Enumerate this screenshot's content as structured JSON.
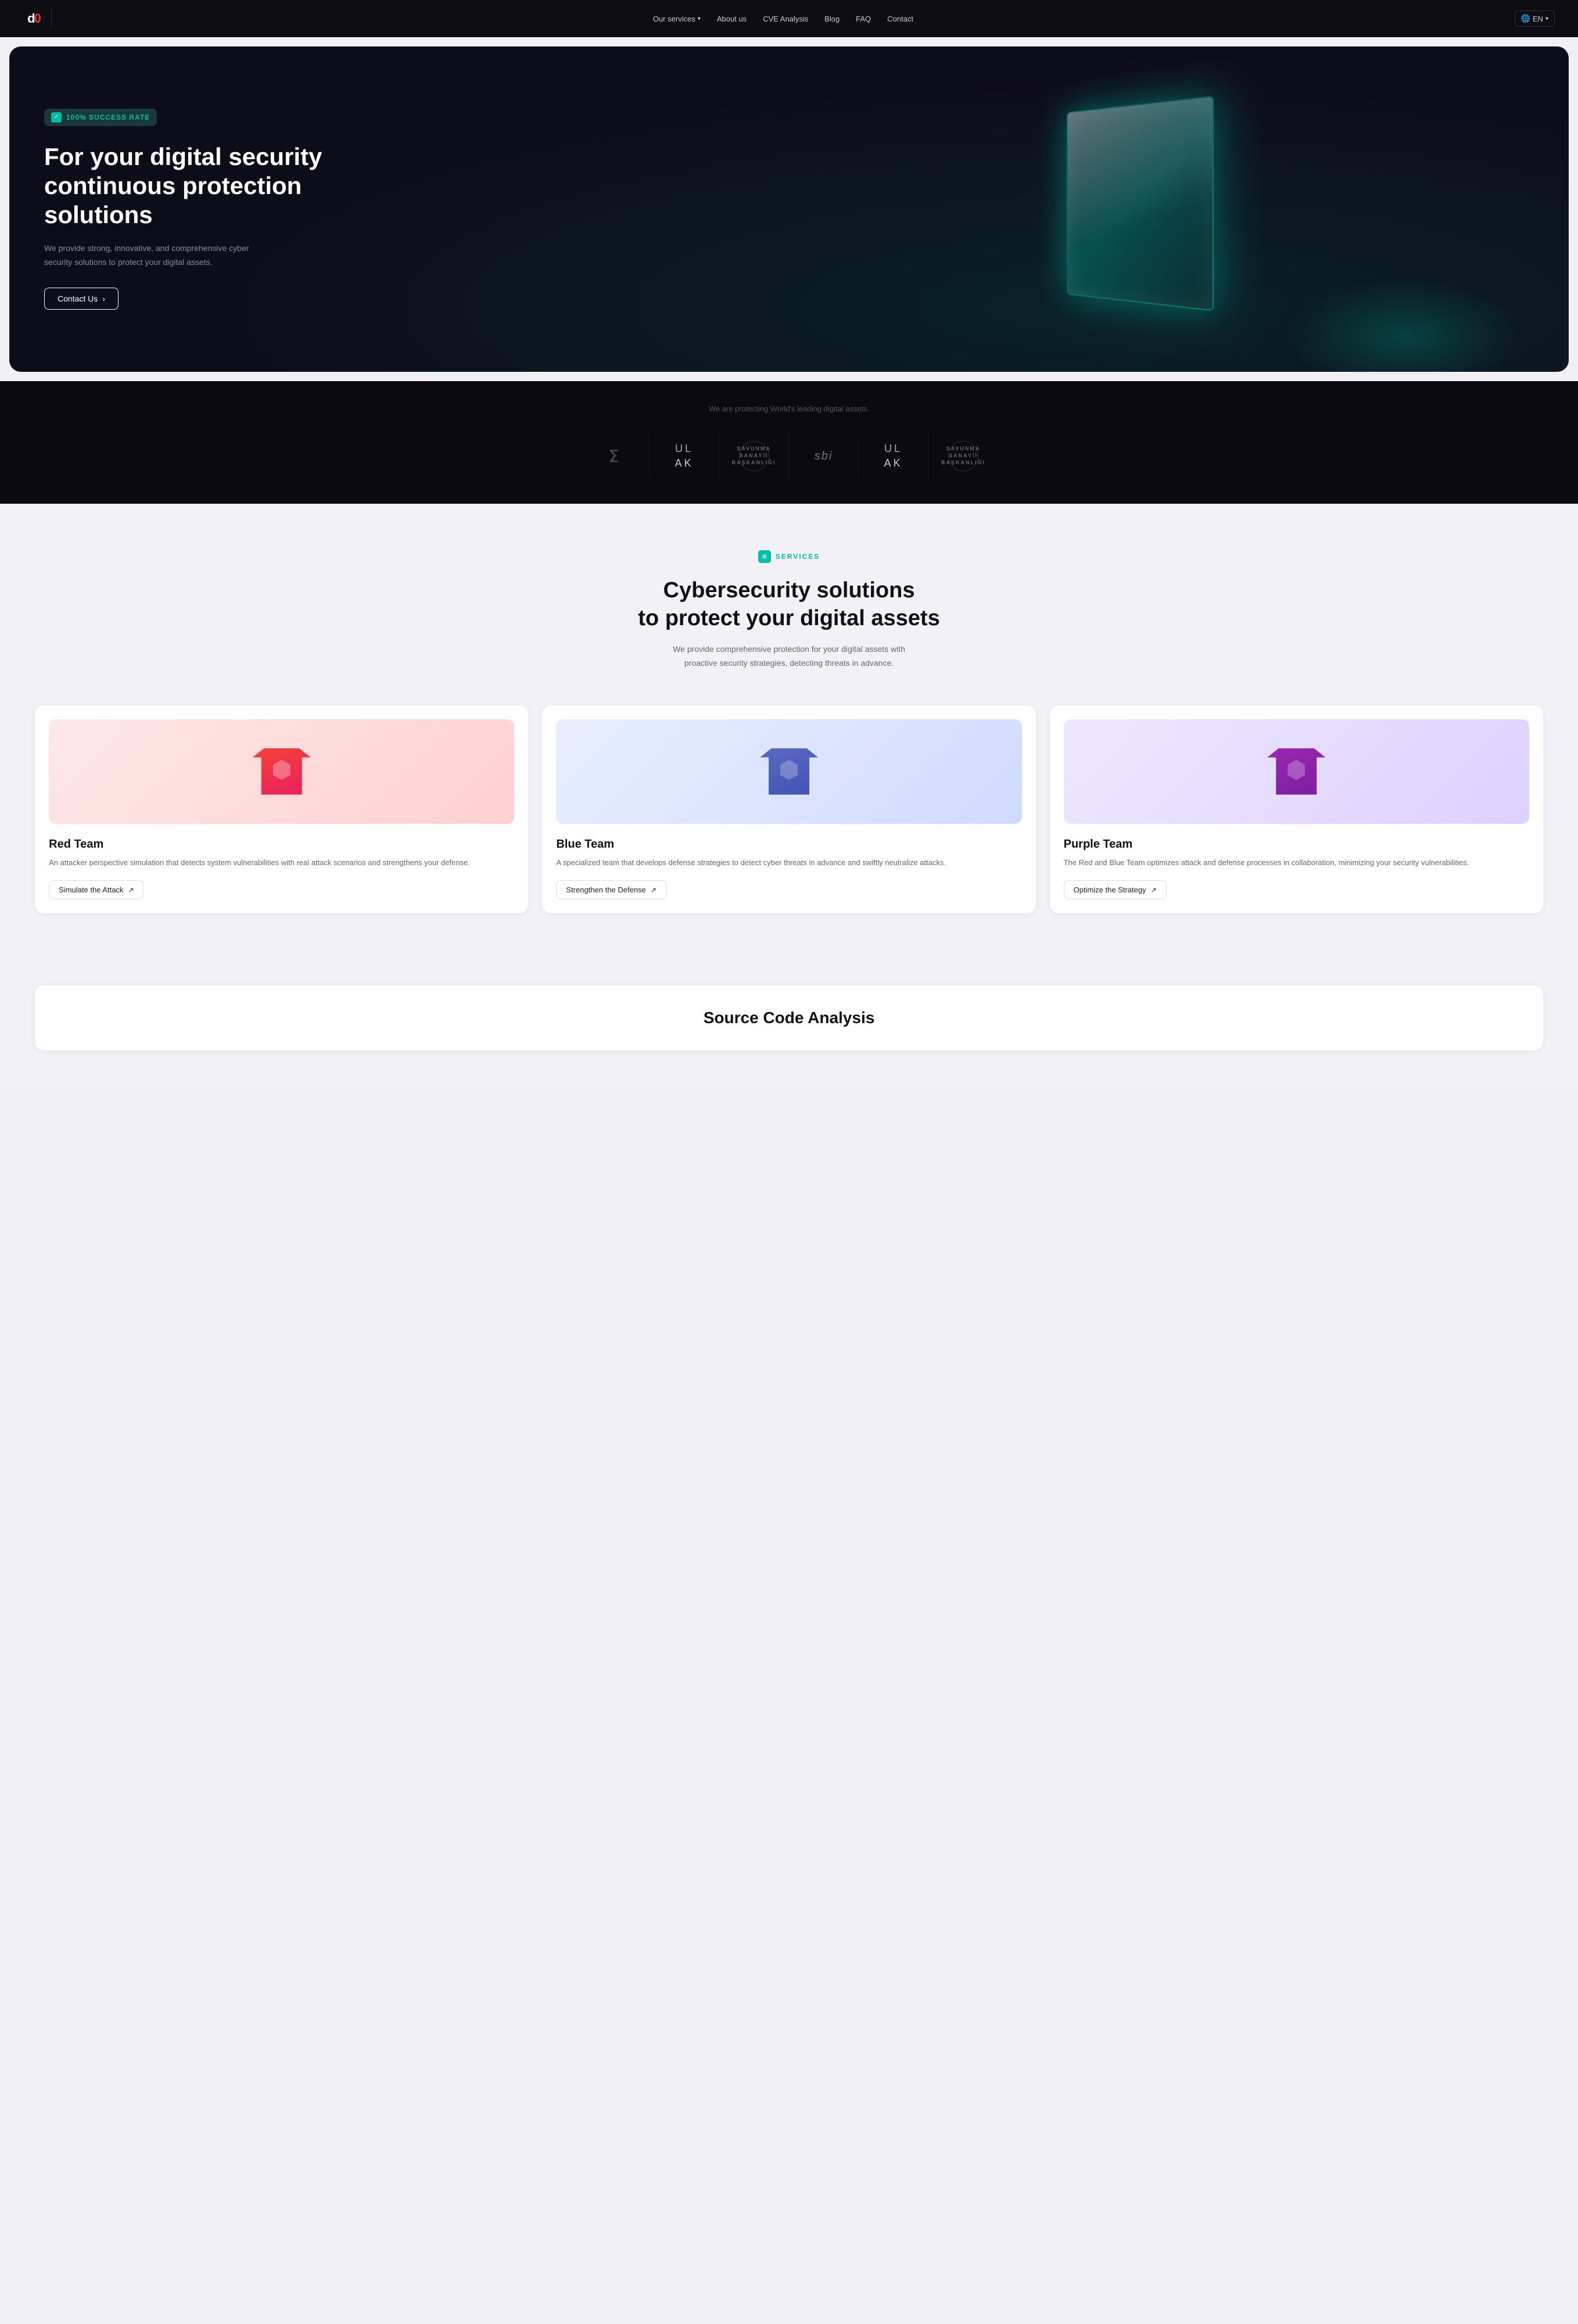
{
  "nav": {
    "logo_text": "d0",
    "links": [
      {
        "label": "Our services",
        "has_dropdown": true
      },
      {
        "label": "About us"
      },
      {
        "label": "CVE Analysis"
      },
      {
        "label": "Blog"
      },
      {
        "label": "FAQ"
      },
      {
        "label": "Contact"
      }
    ],
    "language_btn": "🌐",
    "language_code": "EN"
  },
  "hero": {
    "badge_icon": "✓",
    "badge_text": "100% SUCCESS RATE",
    "headline_line1": "For your digital security",
    "headline_line2": "continuous protection",
    "headline_line3": "solutions",
    "description": "We provide strong, innovative, and comprehensive cyber security solutions to protect your digital assets.",
    "cta_label": "Contact Us",
    "cta_arrow": "›"
  },
  "trusted": {
    "subtitle": "We are protecting World's leading digital assets.",
    "logos": [
      {
        "id": "logo-1",
        "type": "symbol",
        "text": "ⵉ"
      },
      {
        "id": "logo-2",
        "type": "ulak",
        "text": "ULAK"
      },
      {
        "id": "logo-3",
        "type": "ssb",
        "text": "SSB"
      },
      {
        "id": "logo-4",
        "type": "sbi",
        "text": "sbi"
      },
      {
        "id": "logo-5",
        "type": "ulak",
        "text": "ULAK"
      },
      {
        "id": "logo-6",
        "type": "ssb",
        "text": "SSB"
      }
    ]
  },
  "services": {
    "section_icon": "⊞",
    "section_label": "SERVICES",
    "headline_line1": "Cybersecurity solutions",
    "headline_line2": "to protect your digital assets",
    "subtitle": "We provide comprehensive protection for your digital assets with proactive security strategies, detecting threats in advance.",
    "cards": [
      {
        "id": "red-team",
        "color": "red",
        "title": "Red Team",
        "description": "An attacker perspective simulation that detects system vulnerabilities with real attack scenarios and strengthens your defense.",
        "cta": "Simulate the Attack",
        "cta_arrow": "↗"
      },
      {
        "id": "blue-team",
        "color": "blue",
        "title": "Blue Team",
        "description": "A specialized team that develops defense strategies to detect cyber threats in advance and swiftly neutralize attacks.",
        "cta": "Strengthen the Defense",
        "cta_arrow": "↗"
      },
      {
        "id": "purple-team",
        "color": "purple",
        "title": "Purple Team",
        "description": "The Red and Blue Team optimizes attack and defense processes in collaboration, minimizing your security vulnerabilities.",
        "cta": "Optimize the Strategy",
        "cta_arrow": "↗"
      }
    ]
  },
  "source_code": {
    "title": "Source Code Analysis"
  }
}
